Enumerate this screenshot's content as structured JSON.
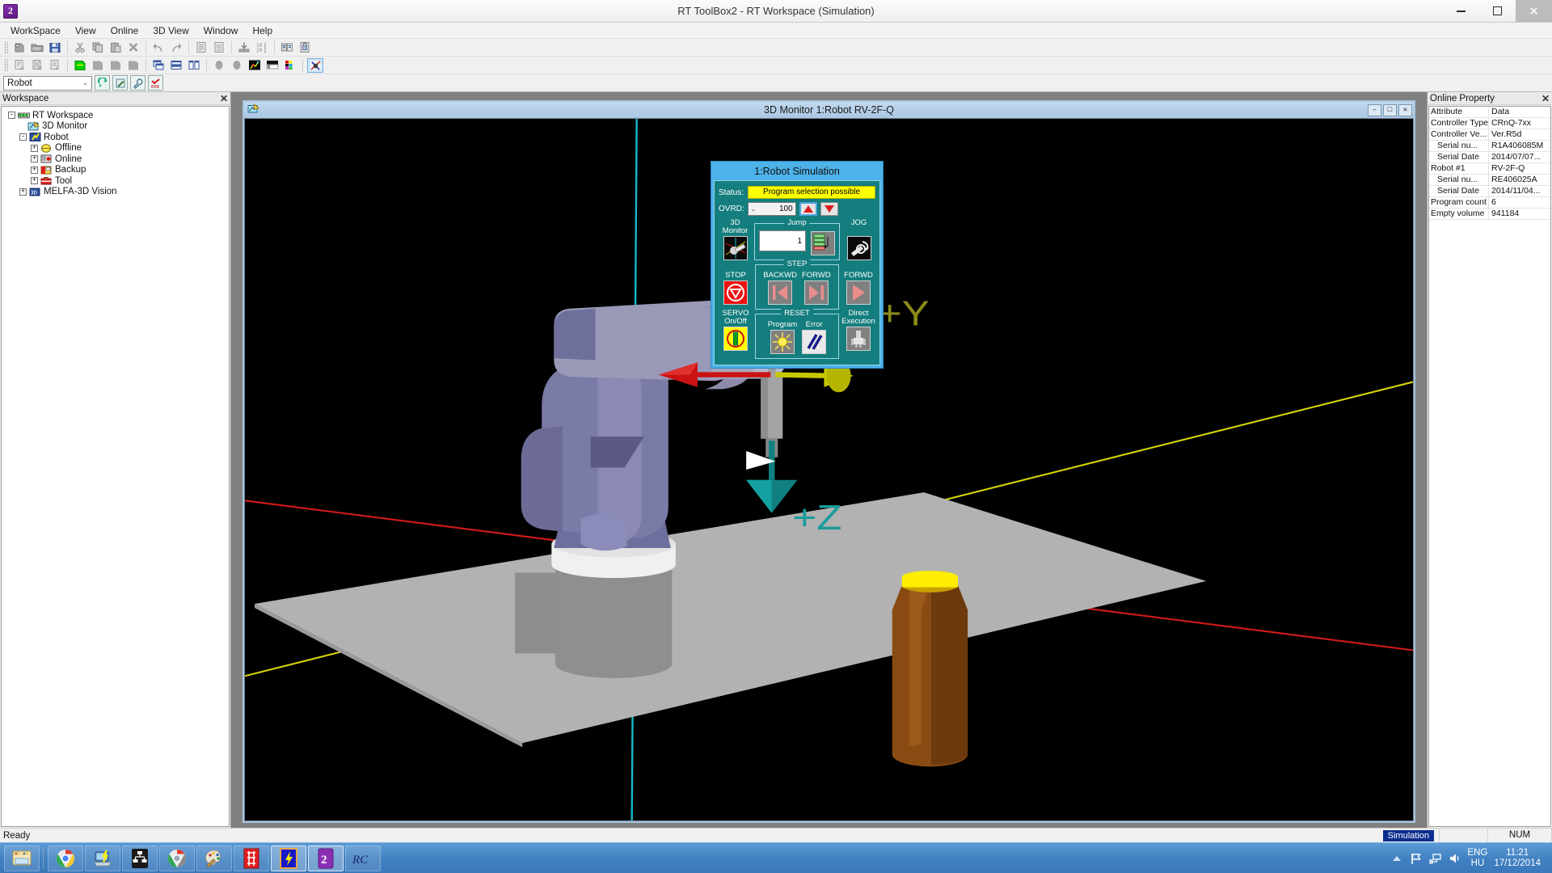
{
  "window": {
    "title": "RT ToolBox2 - RT Workspace  (Simulation)",
    "logo_text": "2",
    "minimize": "—",
    "maximize": "❐",
    "close": "✕"
  },
  "menubar": {
    "items": [
      {
        "label": "WorkSpace"
      },
      {
        "label": "View"
      },
      {
        "label": "Online"
      },
      {
        "label": "3D View"
      },
      {
        "label": "Window"
      },
      {
        "label": "Help"
      }
    ]
  },
  "toolbar1": {
    "icons": [
      "new-workspace-icon",
      "open-folder-icon",
      "save-icon",
      "cut-icon",
      "copy-icon",
      "paste-icon",
      "delete-icon",
      "undo-icon",
      "redo-icon",
      "program-list-icon",
      "program-edit-icon",
      "download-icon",
      "line-number-icon",
      "compare-icon",
      "protect-icon"
    ]
  },
  "toolbar2": {
    "icons": [
      "new-program-icon",
      "open-program-icon",
      "print-program-icon",
      "layout-green-icon",
      "layout-gray-1-icon",
      "layout-gray-2-icon",
      "layout-gray-3-icon",
      "cascade-icon",
      "tile-horizontal-icon",
      "tile-vertical-icon",
      "sphere-gray-1-icon",
      "sphere-gray-2-icon",
      "chart-icon",
      "gradient-icon",
      "palette-icon",
      "simulation-icon"
    ],
    "selected_icon": "simulation-icon"
  },
  "combobar": {
    "combo_value": "Robot",
    "combo_arrow": "⌄",
    "buttons": [
      "refresh-icon",
      "edit-icon",
      "tool-icon",
      "error-icon"
    ]
  },
  "workspace_panel": {
    "header": "Workspace",
    "close_glyph": "✕",
    "tree": [
      {
        "label": "RT Workspace",
        "level": 0,
        "expander": "-",
        "icon": "rt-workspace-icon"
      },
      {
        "label": "3D Monitor",
        "level": 1,
        "expander": "",
        "icon": "3d-monitor-icon"
      },
      {
        "label": "Robot",
        "level": 1,
        "expander": "-",
        "icon": "robot-icon"
      },
      {
        "label": "Offline",
        "level": 2,
        "expander": "+",
        "icon": "offline-icon"
      },
      {
        "label": "Online",
        "level": 2,
        "expander": "+",
        "icon": "online-icon"
      },
      {
        "label": "Backup",
        "level": 2,
        "expander": "+",
        "icon": "backup-icon"
      },
      {
        "label": "Tool",
        "level": 2,
        "expander": "+",
        "icon": "tool-box-icon"
      },
      {
        "label": "MELFA-3D Vision",
        "level": 1,
        "expander": "+",
        "icon": "vision-3d-icon"
      }
    ]
  },
  "mdi_window": {
    "title": "3D Monitor 1:Robot RV-2F-Q",
    "icon": "3d-monitor-icon",
    "buttons": [
      {
        "name": "minimize-button",
        "glyph": "–"
      },
      {
        "name": "restore-button",
        "glyph": "□"
      },
      {
        "name": "close-button",
        "glyph": "✕"
      }
    ]
  },
  "scene": {
    "axis_labels": [
      {
        "name": "axis-label-y",
        "text": "+Y",
        "color": "#8a8a18"
      },
      {
        "name": "axis-label-z",
        "text": "+Z",
        "color": "#1a9b9b"
      }
    ],
    "colors": {
      "background": "#000000",
      "floor": "#b0b0b0",
      "robot_body": "#7b7ba8",
      "robot_upper": "#9a9ab8",
      "robot_base": "#8f8f8f",
      "bottle_body": "#8a4b12",
      "bottle_cap": "#ffee00",
      "axis_x": "#d31a1a",
      "axis_y": "#d7d700",
      "axis_z": "#19c4c4",
      "arrow_x": "#cc1111",
      "arrow_y": "#c8c800",
      "arrow_z": "#108080"
    }
  },
  "sim_panel": {
    "title": "1:Robot  Simulation",
    "status_label": "Status:",
    "status_value": "Program selection possible",
    "ovrd_label": "OVRD:",
    "ovrd_value": "100",
    "ovrd_arrow": "⌄",
    "spin_up": "spin-up-button",
    "spin_down": "spin-down-button",
    "monitor_3d_caption": "3D\nMonitor",
    "monitor_3d_line1": "3D",
    "monitor_3d_line2": "Monitor",
    "jog_caption": "JOG",
    "jump_legend": "Jump",
    "jump_value": "1",
    "step_legend": "STEP",
    "step_backwd": "BACKWD",
    "step_forwd": "FORWD",
    "forwd_caption": "FORWD",
    "stop_caption": "STOP",
    "servo_line1": "SERVO",
    "servo_line2": "On/Off",
    "reset_legend": "RESET",
    "reset_program": "Program",
    "reset_error": "Error",
    "direct_line1": "Direct",
    "direct_line2": "Execution",
    "colors": {
      "panel_border": "#4db2e8",
      "panel_body": "#147d7d",
      "status_bg": "#ffff00",
      "stop_bg": "#ee1111",
      "servo_bg": "#ffff00"
    }
  },
  "online_property": {
    "header": "Online Property",
    "close_glyph": "✕",
    "columns": [
      "Attribute",
      "Data"
    ],
    "rows": [
      {
        "attribute": "Controller Type",
        "data": "CRnQ-7xx",
        "indent": false
      },
      {
        "attribute": "Controller Ve...",
        "data": "Ver.R5d",
        "indent": false
      },
      {
        "attribute": "Serial nu...",
        "data": "R1A406085M",
        "indent": true
      },
      {
        "attribute": "Serial Date",
        "data": "2014/07/07...",
        "indent": true
      },
      {
        "attribute": "Robot #1",
        "data": "RV-2F-Q",
        "indent": false
      },
      {
        "attribute": "Serial nu...",
        "data": "RE406025A",
        "indent": true
      },
      {
        "attribute": "Serial Date",
        "data": "2014/11/04...",
        "indent": true
      },
      {
        "attribute": "Program count",
        "data": "6",
        "indent": false
      },
      {
        "attribute": "Empty volume",
        "data": "941184",
        "indent": false
      }
    ]
  },
  "statusbar": {
    "message": "Ready",
    "simulation_badge": "Simulation",
    "num_indicator": "NUM"
  },
  "taskbar": {
    "items": [
      {
        "name": "taskbar-explorer",
        "icon": "folder-icon",
        "active": false
      },
      {
        "name": "taskbar-chrome-1",
        "icon": "chrome-icon",
        "active": false
      },
      {
        "name": "taskbar-network",
        "icon": "network-pc-icon",
        "active": false
      },
      {
        "name": "taskbar-tree",
        "icon": "hierarchy-icon",
        "active": false
      },
      {
        "name": "taskbar-chrome-2",
        "icon": "chrome-icon",
        "active": false
      },
      {
        "name": "taskbar-paint",
        "icon": "paint-icon",
        "active": false
      },
      {
        "name": "taskbar-cad",
        "icon": "red-tool-icon",
        "active": false
      },
      {
        "name": "taskbar-melfa",
        "icon": "lightning-icon",
        "active": true
      },
      {
        "name": "taskbar-rttoolbox",
        "icon": "rt-toolbox-icon",
        "active": true
      },
      {
        "name": "taskbar-rc",
        "icon": "rc-icon",
        "active": false
      }
    ],
    "tray": {
      "show_hidden": "▲",
      "icons": [
        "flag-icon",
        "network-icon",
        "volume-icon"
      ],
      "language_line1": "ENG",
      "language_line2": "HU",
      "time": "11:21",
      "date": "17/12/2014"
    }
  }
}
